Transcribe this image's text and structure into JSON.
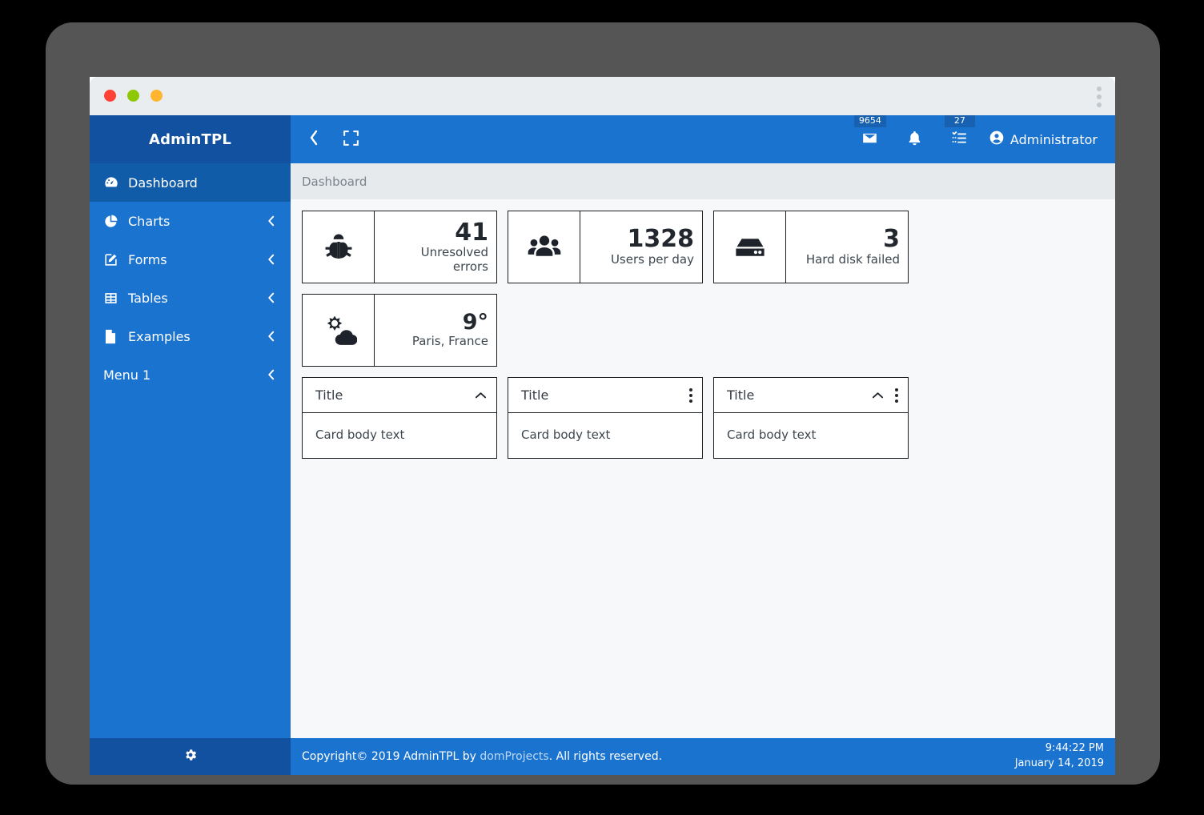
{
  "window": {
    "traffic_lights": [
      "close",
      "minimize",
      "maximize"
    ],
    "menu_icon": "kebab-menu-icon"
  },
  "sidebar": {
    "brand": "AdminTPL",
    "items": [
      {
        "label": "Dashboard",
        "icon": "dashboard-gauge-icon",
        "active": true,
        "caret": false
      },
      {
        "label": "Charts",
        "icon": "pie-chart-icon",
        "active": false,
        "caret": true
      },
      {
        "label": "Forms",
        "icon": "edit-form-icon",
        "active": false,
        "caret": true
      },
      {
        "label": "Tables",
        "icon": "table-grid-icon",
        "active": false,
        "caret": true
      },
      {
        "label": "Examples",
        "icon": "file-document-icon",
        "active": false,
        "caret": true
      },
      {
        "label": "Menu 1",
        "icon": "",
        "active": false,
        "caret": true
      }
    ],
    "footer_icon": "gear-icon"
  },
  "topbar": {
    "collapse_icon": "chevron-left-icon",
    "fullscreen_icon": "fullscreen-expand-icon",
    "icons": [
      {
        "name": "mail-envelope-icon",
        "badge": "9654"
      },
      {
        "name": "bell-notification-icon",
        "badge": ""
      },
      {
        "name": "tasks-checklist-icon",
        "badge": "27"
      }
    ],
    "user_icon": "user-account-icon",
    "user_name": "Administrator"
  },
  "breadcrumb": "Dashboard",
  "stats": [
    {
      "icon": "bug-icon",
      "value": "41",
      "label": "Unresolved errors"
    },
    {
      "icon": "users-icon",
      "value": "1328",
      "label": "Users per day"
    },
    {
      "icon": "harddisk-icon",
      "value": "3",
      "label": "Hard disk failed"
    },
    {
      "icon": "weather-partly-cloudy-icon",
      "value": "9°",
      "label": "Paris, France"
    }
  ],
  "cards": [
    {
      "title": "Title",
      "body": "Card body text",
      "collapse_icon": "chevron-up-icon",
      "menu_icon": ""
    },
    {
      "title": "Title",
      "body": "Card body text",
      "collapse_icon": "",
      "menu_icon": "kebab-menu-icon"
    },
    {
      "title": "Title",
      "body": "Card body text",
      "collapse_icon": "chevron-up-icon",
      "menu_icon": "kebab-menu-icon"
    }
  ],
  "footer": {
    "copyright_prefix": "Copyright© 2019 AdminTPL by ",
    "link": "domProjects",
    "copyright_suffix": ". All rights reserved.",
    "time": "9:44:22 PM",
    "date": "January 14, 2019"
  },
  "colors": {
    "sidebar_blue": "#1b73d0",
    "brand_blue": "#11519f",
    "active_blue": "#115ca8",
    "badge_blue": "#1761b0",
    "breadcrumb_bg": "#e7eaec",
    "content_bg": "#f7f8f9",
    "frame_gray": "#555555"
  }
}
